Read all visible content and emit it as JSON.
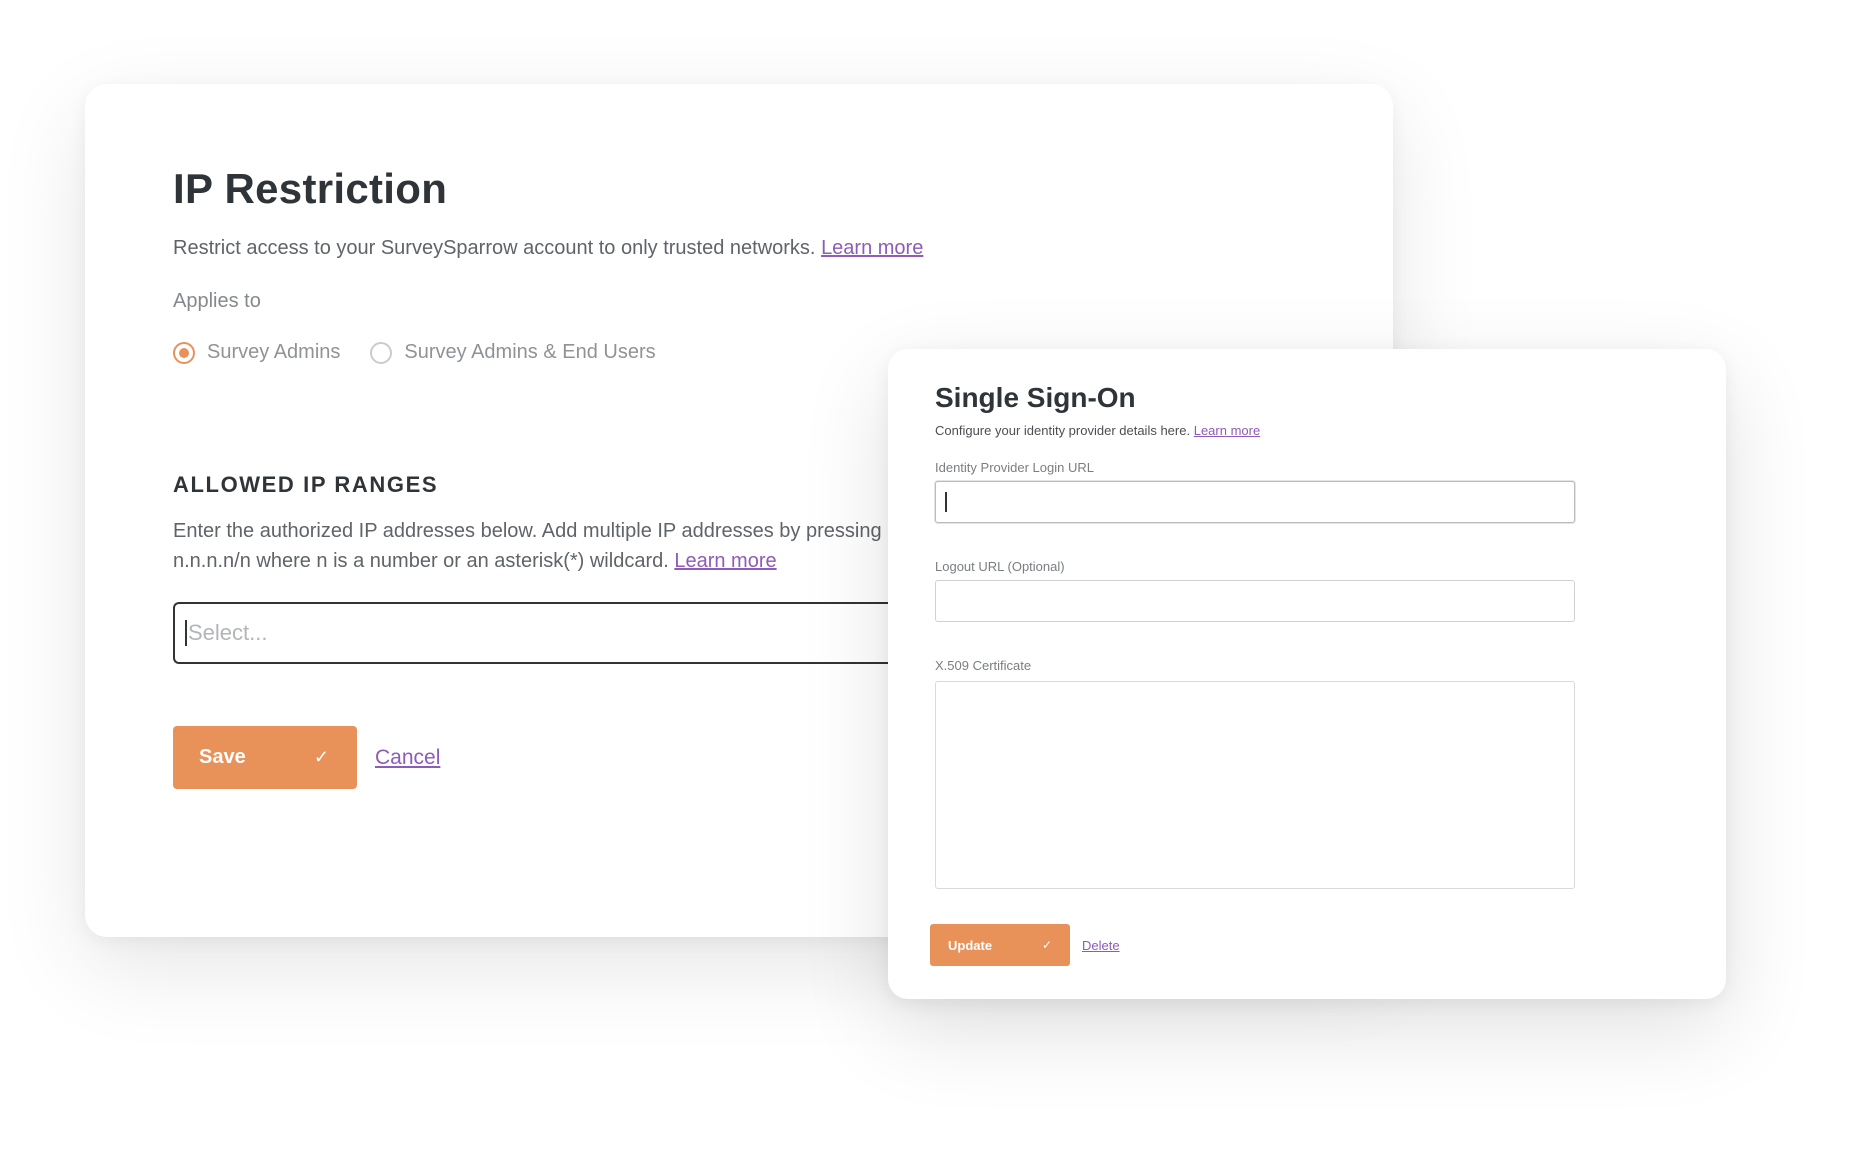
{
  "ip_restriction": {
    "title": "IP Restriction",
    "description": "Restrict access to your SurveySparrow account to only trusted networks.",
    "learn_more": "Learn more",
    "applies_to_label": "Applies to",
    "radio_options": [
      {
        "label": "Survey Admins",
        "checked": true
      },
      {
        "label": "Survey Admins & End Users",
        "checked": false
      }
    ],
    "allowed_ranges_heading": "ALLOWED IP RANGES",
    "allowed_ranges_desc_line1": "Enter the authorized IP addresses below. Add multiple IP addresses by pressing",
    "allowed_ranges_desc_line2": "n.n.n.n/n where n is a number or an asterisk(*) wildcard.",
    "allowed_ranges_learn_more": "Learn more",
    "select_placeholder": "Select...",
    "save_label": "Save",
    "cancel_label": "Cancel"
  },
  "sso": {
    "title": "Single Sign-On",
    "description": "Configure your identity provider details here.",
    "learn_more": "Learn more",
    "login_url_label": "Identity Provider Login URL",
    "login_url_value": "",
    "logout_url_label": "Logout URL (Optional)",
    "logout_url_value": "",
    "certificate_label": "X.509 Certificate",
    "certificate_value": "",
    "update_label": "Update",
    "delete_label": "Delete"
  },
  "icons": {
    "check": "check-icon"
  },
  "colors": {
    "accent": "#e8925a",
    "link": "#8e5cb8",
    "heading": "#2f3438"
  }
}
